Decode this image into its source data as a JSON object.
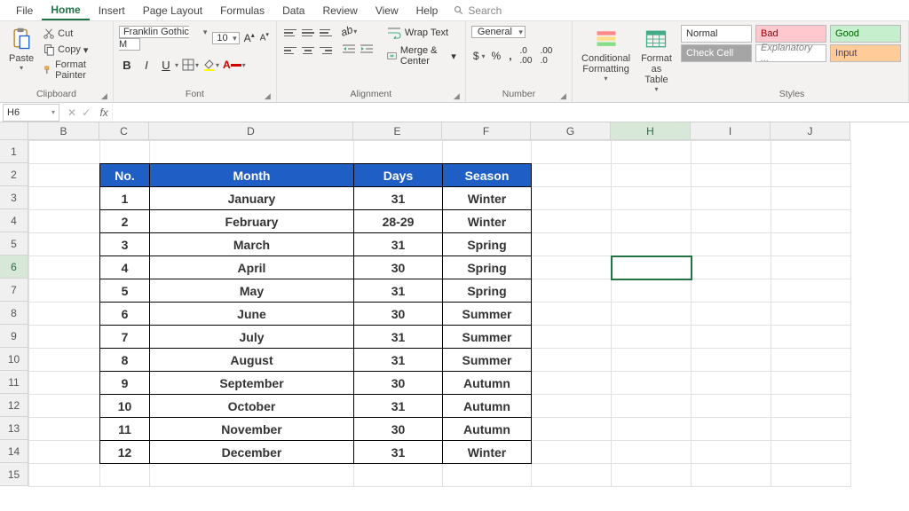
{
  "menu": {
    "items": [
      "File",
      "Home",
      "Insert",
      "Page Layout",
      "Formulas",
      "Data",
      "Review",
      "View",
      "Help"
    ],
    "active": "Home",
    "search": "Search"
  },
  "ribbon": {
    "clipboard": {
      "label": "Clipboard",
      "paste": "Paste",
      "cut": "Cut",
      "copy": "Copy",
      "format_painter": "Format Painter"
    },
    "font": {
      "label": "Font",
      "name": "Franklin Gothic M",
      "size": "10"
    },
    "alignment": {
      "label": "Alignment",
      "wrap": "Wrap Text",
      "merge": "Merge & Center"
    },
    "number": {
      "label": "Number",
      "format": "General"
    },
    "cond_format": "Conditional Formatting",
    "format_table": "Format as Table",
    "styles": {
      "label": "Styles",
      "normal": "Normal",
      "bad": "Bad",
      "good": "Good",
      "check": "Check Cell",
      "explanatory": "Explanatory ...",
      "input": "Input"
    }
  },
  "namebox": "H6",
  "columns": [
    "B",
    "C",
    "D",
    "E",
    "F",
    "G",
    "H",
    "I",
    "J"
  ],
  "rows": [
    "1",
    "2",
    "3",
    "4",
    "5",
    "6",
    "7",
    "8",
    "9",
    "10",
    "11",
    "12",
    "13",
    "14",
    "15"
  ],
  "active_cell": "H6",
  "table": {
    "headers": {
      "no": "No.",
      "month": "Month",
      "days": "Days",
      "season": "Season"
    },
    "rows": [
      {
        "no": "1",
        "month": "January",
        "days": "31",
        "season": "Winter"
      },
      {
        "no": "2",
        "month": "February",
        "days": "28-29",
        "season": "Winter"
      },
      {
        "no": "3",
        "month": "March",
        "days": "31",
        "season": "Spring"
      },
      {
        "no": "4",
        "month": "April",
        "days": "30",
        "season": "Spring"
      },
      {
        "no": "5",
        "month": "May",
        "days": "31",
        "season": "Spring"
      },
      {
        "no": "6",
        "month": "June",
        "days": "30",
        "season": "Summer"
      },
      {
        "no": "7",
        "month": "July",
        "days": "31",
        "season": "Summer"
      },
      {
        "no": "8",
        "month": "August",
        "days": "31",
        "season": "Summer"
      },
      {
        "no": "9",
        "month": "September",
        "days": "30",
        "season": "Autumn"
      },
      {
        "no": "10",
        "month": "October",
        "days": "31",
        "season": "Autumn"
      },
      {
        "no": "11",
        "month": "November",
        "days": "30",
        "season": "Autumn"
      },
      {
        "no": "12",
        "month": "December",
        "days": "31",
        "season": "Winter"
      }
    ]
  }
}
